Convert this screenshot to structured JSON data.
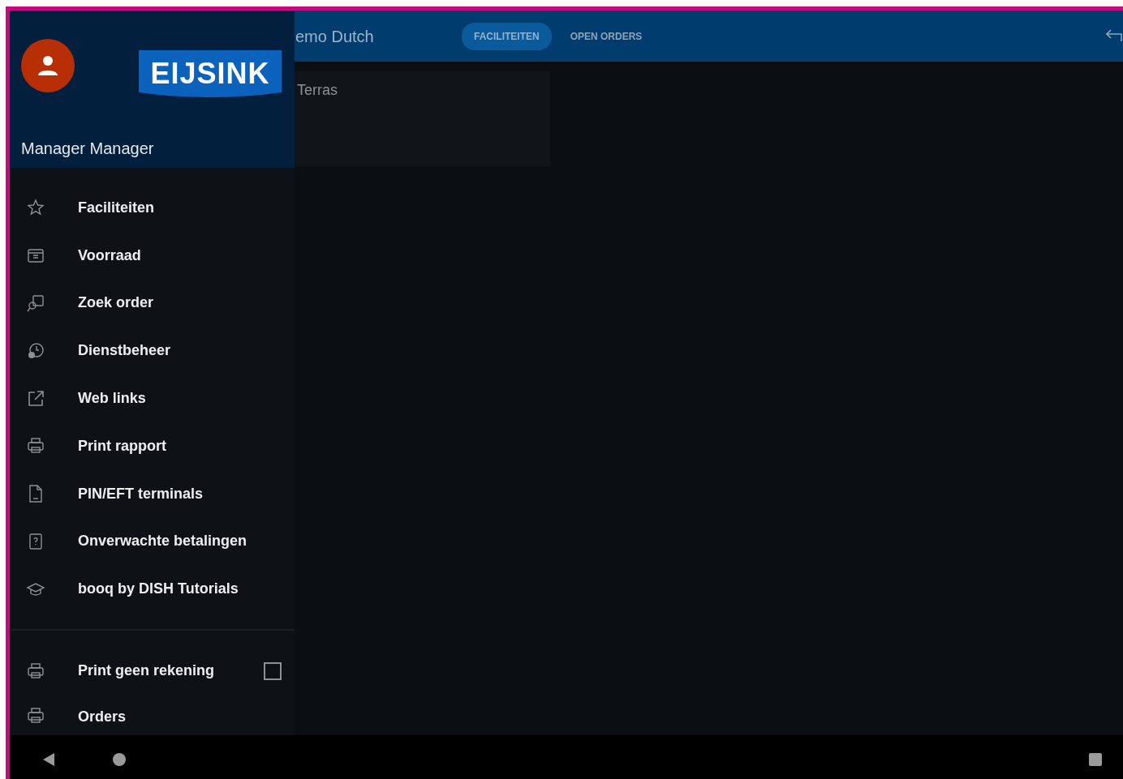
{
  "app_bar": {
    "title": "emo Dutch",
    "tabs": [
      {
        "label": "FACILITEITEN",
        "selected": true
      },
      {
        "label": "OPEN ORDERS",
        "selected": false
      }
    ]
  },
  "content": {
    "cards": [
      {
        "title": "Terras"
      }
    ]
  },
  "drawer": {
    "logo_text": "EIJSINK",
    "user_name": "Manager Manager",
    "items": [
      {
        "label": "Faciliteiten"
      },
      {
        "label": "Voorraad"
      },
      {
        "label": "Zoek order"
      },
      {
        "label": "Dienstbeheer"
      },
      {
        "label": "Web links"
      },
      {
        "label": "Print rapport"
      },
      {
        "label": "PIN/EFT terminals"
      },
      {
        "label": "Onverwachte betalingen"
      },
      {
        "label": "booq by DISH Tutorials"
      }
    ],
    "settings": [
      {
        "kind": "checkbox",
        "label": "Print geen rekening",
        "checked": false
      },
      {
        "kind": "item",
        "label": "Orders"
      }
    ]
  }
}
